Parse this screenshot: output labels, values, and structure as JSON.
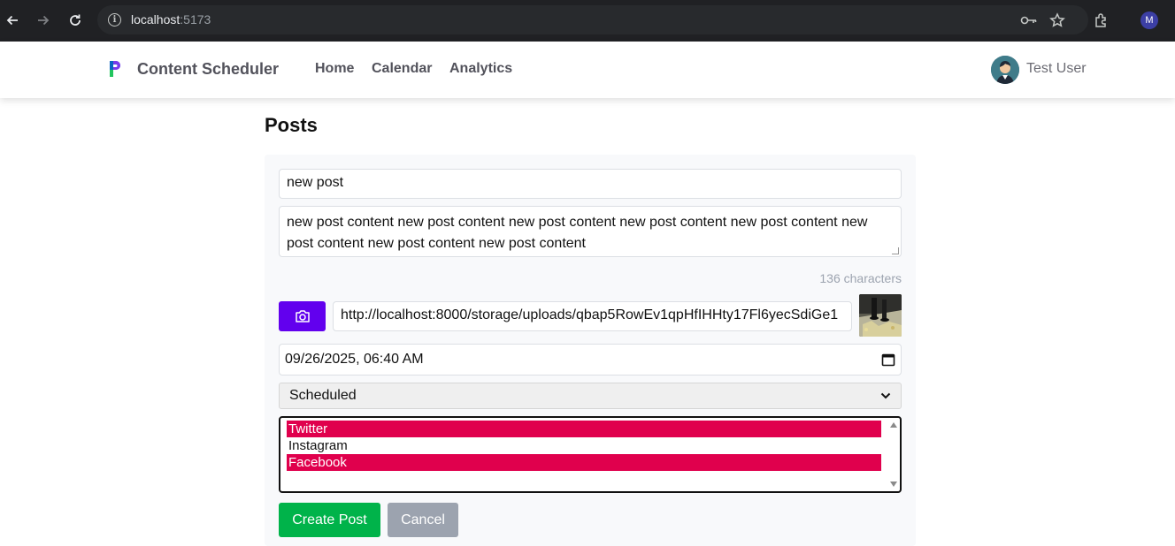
{
  "browser": {
    "url_host": "localhost",
    "url_port": ":5173",
    "profile_initial": "M"
  },
  "app": {
    "brand": "Content Scheduler",
    "nav": [
      {
        "label": "Home"
      },
      {
        "label": "Calendar"
      },
      {
        "label": "Analytics"
      }
    ],
    "user_name": "Test User"
  },
  "main": {
    "title": "Posts",
    "form": {
      "title_value": "new post",
      "content_value": "new post content new post content new post content new post content new post content new post content new post content new post content",
      "char_count": "136 characters",
      "image_url_value": "http://localhost:8000/storage/uploads/qbap5RowEv1qpHfIHHty17Fl6yecSdiGe1",
      "datetime_value": "09/26/2025, 06:40 AM",
      "status_value": "Scheduled",
      "platforms": [
        {
          "label": "Twitter",
          "selected": true
        },
        {
          "label": "Instagram",
          "selected": false
        },
        {
          "label": "Facebook",
          "selected": true
        }
      ],
      "create_label": "Create Post",
      "cancel_label": "Cancel"
    }
  },
  "colors": {
    "upload_button": "#6200ee",
    "create_button": "#00b34a",
    "cancel_button": "#9ca3af",
    "selected_option": "#e0004d"
  },
  "icons": [
    "back-arrow-icon",
    "forward-arrow-icon",
    "reload-icon",
    "site-info-icon",
    "password-key-icon",
    "bookmark-star-icon",
    "extensions-icon",
    "camera-icon",
    "calendar-icon",
    "chevron-down-icon"
  ]
}
